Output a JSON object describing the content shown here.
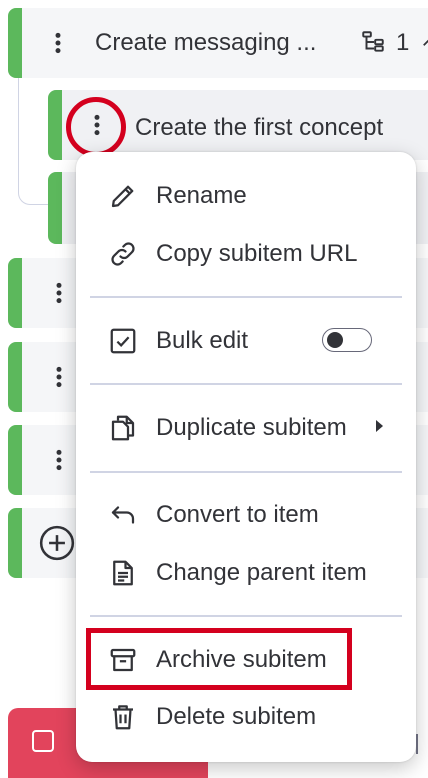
{
  "parent_item": {
    "title": "Create messaging ...",
    "subitem_count": "1"
  },
  "subitem": {
    "title": "Create the first concept"
  },
  "colors": {
    "group": "#5cb85c",
    "highlight": "#d4001e",
    "new_button": "#e2445c"
  },
  "menu": {
    "rename": "Rename",
    "copy_url": "Copy subitem URL",
    "bulk_edit": "Bulk edit",
    "duplicate": "Duplicate subitem",
    "convert": "Convert to item",
    "change_parent": "Change parent item",
    "archive": "Archive subitem",
    "delete": "Delete subitem"
  },
  "icons": [
    "more-vertical-icon",
    "subitems-icon",
    "pencil-icon",
    "link-icon",
    "checkbox-icon",
    "duplicate-icon",
    "chevron-right-icon",
    "convert-icon",
    "document-icon",
    "archive-icon",
    "trash-icon",
    "add-circle-icon"
  ]
}
